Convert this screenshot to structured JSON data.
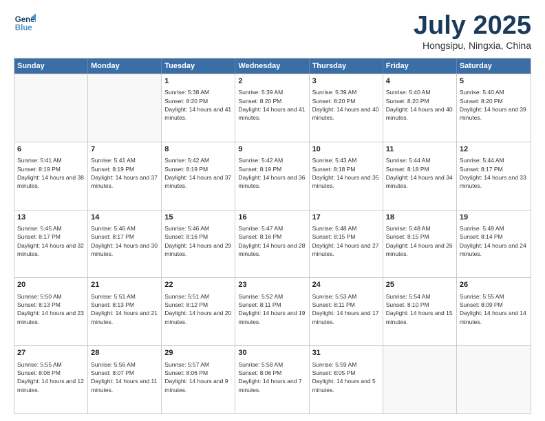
{
  "logo": {
    "line1": "General",
    "line2": "Blue"
  },
  "title": "July 2025",
  "location": "Hongsipu, Ningxia, China",
  "days_of_week": [
    "Sunday",
    "Monday",
    "Tuesday",
    "Wednesday",
    "Thursday",
    "Friday",
    "Saturday"
  ],
  "weeks": [
    [
      {
        "day": "",
        "sunrise": "",
        "sunset": "",
        "daylight": ""
      },
      {
        "day": "",
        "sunrise": "",
        "sunset": "",
        "daylight": ""
      },
      {
        "day": "1",
        "sunrise": "Sunrise: 5:38 AM",
        "sunset": "Sunset: 8:20 PM",
        "daylight": "Daylight: 14 hours and 41 minutes."
      },
      {
        "day": "2",
        "sunrise": "Sunrise: 5:39 AM",
        "sunset": "Sunset: 8:20 PM",
        "daylight": "Daylight: 14 hours and 41 minutes."
      },
      {
        "day": "3",
        "sunrise": "Sunrise: 5:39 AM",
        "sunset": "Sunset: 8:20 PM",
        "daylight": "Daylight: 14 hours and 40 minutes."
      },
      {
        "day": "4",
        "sunrise": "Sunrise: 5:40 AM",
        "sunset": "Sunset: 8:20 PM",
        "daylight": "Daylight: 14 hours and 40 minutes."
      },
      {
        "day": "5",
        "sunrise": "Sunrise: 5:40 AM",
        "sunset": "Sunset: 8:20 PM",
        "daylight": "Daylight: 14 hours and 39 minutes."
      }
    ],
    [
      {
        "day": "6",
        "sunrise": "Sunrise: 5:41 AM",
        "sunset": "Sunset: 8:19 PM",
        "daylight": "Daylight: 14 hours and 38 minutes."
      },
      {
        "day": "7",
        "sunrise": "Sunrise: 5:41 AM",
        "sunset": "Sunset: 8:19 PM",
        "daylight": "Daylight: 14 hours and 37 minutes."
      },
      {
        "day": "8",
        "sunrise": "Sunrise: 5:42 AM",
        "sunset": "Sunset: 8:19 PM",
        "daylight": "Daylight: 14 hours and 37 minutes."
      },
      {
        "day": "9",
        "sunrise": "Sunrise: 5:42 AM",
        "sunset": "Sunset: 8:19 PM",
        "daylight": "Daylight: 14 hours and 36 minutes."
      },
      {
        "day": "10",
        "sunrise": "Sunrise: 5:43 AM",
        "sunset": "Sunset: 8:18 PM",
        "daylight": "Daylight: 14 hours and 35 minutes."
      },
      {
        "day": "11",
        "sunrise": "Sunrise: 5:44 AM",
        "sunset": "Sunset: 8:18 PM",
        "daylight": "Daylight: 14 hours and 34 minutes."
      },
      {
        "day": "12",
        "sunrise": "Sunrise: 5:44 AM",
        "sunset": "Sunset: 8:17 PM",
        "daylight": "Daylight: 14 hours and 33 minutes."
      }
    ],
    [
      {
        "day": "13",
        "sunrise": "Sunrise: 5:45 AM",
        "sunset": "Sunset: 8:17 PM",
        "daylight": "Daylight: 14 hours and 32 minutes."
      },
      {
        "day": "14",
        "sunrise": "Sunrise: 5:46 AM",
        "sunset": "Sunset: 8:17 PM",
        "daylight": "Daylight: 14 hours and 30 minutes."
      },
      {
        "day": "15",
        "sunrise": "Sunrise: 5:46 AM",
        "sunset": "Sunset: 8:16 PM",
        "daylight": "Daylight: 14 hours and 29 minutes."
      },
      {
        "day": "16",
        "sunrise": "Sunrise: 5:47 AM",
        "sunset": "Sunset: 8:16 PM",
        "daylight": "Daylight: 14 hours and 28 minutes."
      },
      {
        "day": "17",
        "sunrise": "Sunrise: 5:48 AM",
        "sunset": "Sunset: 8:15 PM",
        "daylight": "Daylight: 14 hours and 27 minutes."
      },
      {
        "day": "18",
        "sunrise": "Sunrise: 5:48 AM",
        "sunset": "Sunset: 8:15 PM",
        "daylight": "Daylight: 14 hours and 26 minutes."
      },
      {
        "day": "19",
        "sunrise": "Sunrise: 5:49 AM",
        "sunset": "Sunset: 8:14 PM",
        "daylight": "Daylight: 14 hours and 24 minutes."
      }
    ],
    [
      {
        "day": "20",
        "sunrise": "Sunrise: 5:50 AM",
        "sunset": "Sunset: 8:13 PM",
        "daylight": "Daylight: 14 hours and 23 minutes."
      },
      {
        "day": "21",
        "sunrise": "Sunrise: 5:51 AM",
        "sunset": "Sunset: 8:13 PM",
        "daylight": "Daylight: 14 hours and 21 minutes."
      },
      {
        "day": "22",
        "sunrise": "Sunrise: 5:51 AM",
        "sunset": "Sunset: 8:12 PM",
        "daylight": "Daylight: 14 hours and 20 minutes."
      },
      {
        "day": "23",
        "sunrise": "Sunrise: 5:52 AM",
        "sunset": "Sunset: 8:11 PM",
        "daylight": "Daylight: 14 hours and 19 minutes."
      },
      {
        "day": "24",
        "sunrise": "Sunrise: 5:53 AM",
        "sunset": "Sunset: 8:11 PM",
        "daylight": "Daylight: 14 hours and 17 minutes."
      },
      {
        "day": "25",
        "sunrise": "Sunrise: 5:54 AM",
        "sunset": "Sunset: 8:10 PM",
        "daylight": "Daylight: 14 hours and 15 minutes."
      },
      {
        "day": "26",
        "sunrise": "Sunrise: 5:55 AM",
        "sunset": "Sunset: 8:09 PM",
        "daylight": "Daylight: 14 hours and 14 minutes."
      }
    ],
    [
      {
        "day": "27",
        "sunrise": "Sunrise: 5:55 AM",
        "sunset": "Sunset: 8:08 PM",
        "daylight": "Daylight: 14 hours and 12 minutes."
      },
      {
        "day": "28",
        "sunrise": "Sunrise: 5:56 AM",
        "sunset": "Sunset: 8:07 PM",
        "daylight": "Daylight: 14 hours and 11 minutes."
      },
      {
        "day": "29",
        "sunrise": "Sunrise: 5:57 AM",
        "sunset": "Sunset: 8:06 PM",
        "daylight": "Daylight: 14 hours and 9 minutes."
      },
      {
        "day": "30",
        "sunrise": "Sunrise: 5:58 AM",
        "sunset": "Sunset: 8:06 PM",
        "daylight": "Daylight: 14 hours and 7 minutes."
      },
      {
        "day": "31",
        "sunrise": "Sunrise: 5:59 AM",
        "sunset": "Sunset: 8:05 PM",
        "daylight": "Daylight: 14 hours and 5 minutes."
      },
      {
        "day": "",
        "sunrise": "",
        "sunset": "",
        "daylight": ""
      },
      {
        "day": "",
        "sunrise": "",
        "sunset": "",
        "daylight": ""
      }
    ]
  ]
}
